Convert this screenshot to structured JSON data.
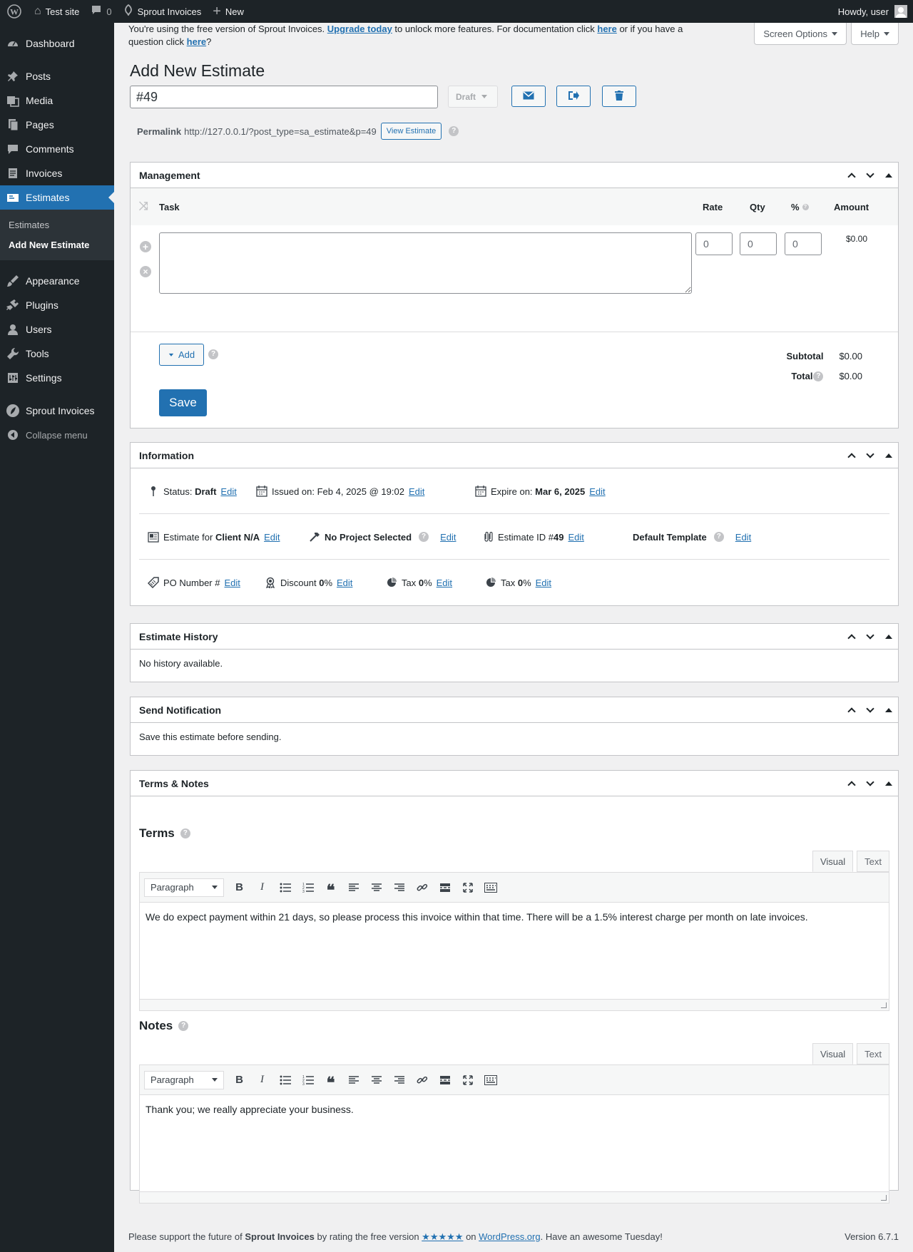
{
  "adminbar": {
    "site_name": "Test site",
    "comments_count": "0",
    "plugin_name": "Sprout Invoices",
    "new_label": "New",
    "howdy": "Howdy, user"
  },
  "sidebar": {
    "items": [
      {
        "label": "Dashboard",
        "icon": "dashboard-icon"
      },
      {
        "label": "Posts",
        "icon": "pin-icon"
      },
      {
        "label": "Media",
        "icon": "media-icon"
      },
      {
        "label": "Pages",
        "icon": "pages-icon"
      },
      {
        "label": "Comments",
        "icon": "comment-icon"
      },
      {
        "label": "Invoices",
        "icon": "invoice-icon"
      },
      {
        "label": "Estimates",
        "icon": "estimate-icon"
      },
      {
        "label": "Appearance",
        "icon": "brush-icon"
      },
      {
        "label": "Plugins",
        "icon": "plug-icon"
      },
      {
        "label": "Users",
        "icon": "user-icon"
      },
      {
        "label": "Tools",
        "icon": "wrench-icon"
      },
      {
        "label": "Settings",
        "icon": "settings-icon"
      },
      {
        "label": "Sprout Invoices",
        "icon": "sprout-icon"
      },
      {
        "label": "Collapse menu",
        "icon": "collapse-icon"
      }
    ],
    "submenu": [
      "Estimates",
      "Add New Estimate"
    ]
  },
  "notice": {
    "text1": "You're using the free version of Sprout Invoices. ",
    "link1": "Upgrade today",
    "text2": " to unlock more features. For documentation click ",
    "link2": "here",
    "text3": " or if you have a question click ",
    "link3": "here",
    "text4": "?"
  },
  "screen_options": "Screen Options",
  "help_label": "Help",
  "page_title": "Add New Estimate",
  "estimate_title": "#49",
  "status_label": "Draft",
  "permalink": {
    "label": "Permalink",
    "url": "http://127.0.0.1/?post_type=sa_estimate&p=49",
    "view_button": "View Estimate"
  },
  "management": {
    "title": "Management",
    "columns": {
      "task": "Task",
      "rate": "Rate",
      "qty": "Qty",
      "percent": "%",
      "amount": "Amount"
    },
    "row": {
      "rate": "0",
      "qty": "0",
      "percent": "0",
      "amount": "$0.00"
    },
    "add_label": "Add",
    "save_label": "Save",
    "subtotal_label": "Subtotal",
    "subtotal_value": "$0.00",
    "total_label": "Total",
    "total_value": "$0.00"
  },
  "information": {
    "title": "Information",
    "status_prefix": "Status: ",
    "status_value": "Draft",
    "issued": "Issued on: Feb 4, 2025 @ 19:02",
    "expire_prefix": "Expire on: ",
    "expire_value": "Mar 6, 2025",
    "client_prefix": "Estimate for ",
    "client_value": "Client N/A",
    "project": "No Project Selected",
    "estimate_id_prefix": "Estimate ID #",
    "estimate_id_value": "49",
    "template": "Default Template",
    "po_number": "PO Number #",
    "discount_prefix": "Discount ",
    "discount_value": "0",
    "tax_prefix": "Tax ",
    "tax_value": "0",
    "tax2_prefix": "Tax ",
    "tax2_value": "0",
    "percent_sign": "%",
    "edit": "Edit"
  },
  "history": {
    "title": "Estimate History",
    "empty": "No history available."
  },
  "notification": {
    "title": "Send Notification",
    "text": "Save this estimate before sending."
  },
  "terms_notes": {
    "title": "Terms & Notes",
    "terms_label": "Terms",
    "terms_text": "We do expect payment within 21 days, so please process this invoice within that time. There will be a 1.5% interest charge per month on late invoices.",
    "notes_label": "Notes",
    "notes_text": "Thank you; we really appreciate your business.",
    "visual_tab": "Visual",
    "text_tab": "Text",
    "format": "Paragraph"
  },
  "footer": {
    "text1": "Please support the future of ",
    "brand": "Sprout Invoices",
    "text2": " by rating the free version ",
    "stars": "★★★★★",
    "text3": " on ",
    "wporg": "WordPress.org",
    "text4": ". Have an awesome Tuesday!",
    "version": "Version 6.7.1"
  },
  "colors": {
    "accent": "#2271b1",
    "sidebar": "#1d2327",
    "background": "#f0f0f1"
  }
}
